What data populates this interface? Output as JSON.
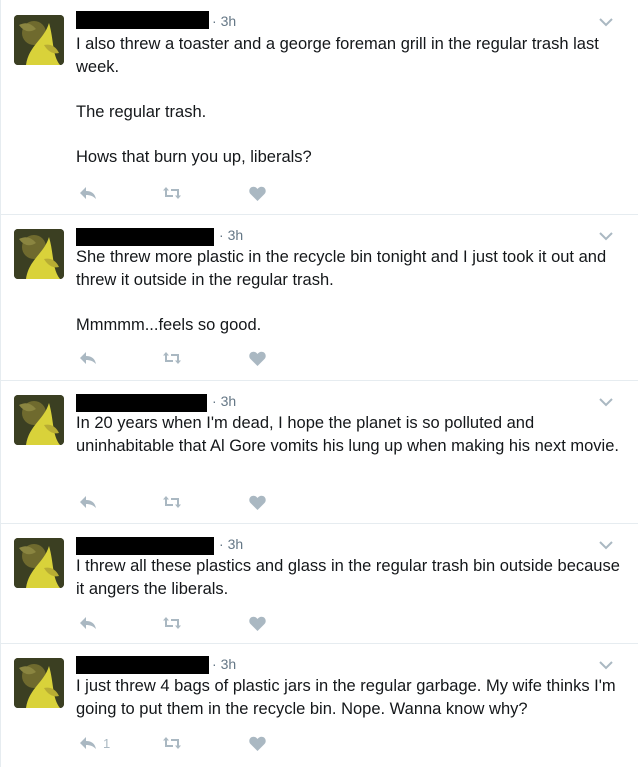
{
  "tweets": [
    {
      "time": "3h",
      "text": "I also threw a toaster and a george foreman grill in the regular trash last week.\n\nThe regular trash.\n\nHows that burn you up, liberals?",
      "reply_count": "",
      "actions": [
        "reply-icon",
        "retweet-icon",
        "like-icon"
      ]
    },
    {
      "time": "3h",
      "text": "She threw more plastic in the recycle bin tonight and I just took it out and threw it outside in the regular trash.\n\nMmmmm...feels so good.",
      "reply_count": "",
      "actions": [
        "reply-icon",
        "retweet-icon",
        "like-icon"
      ]
    },
    {
      "time": "3h",
      "text": "In 20 years when I'm dead, I hope the planet is so polluted and uninhabitable that Al Gore vomits his lung up when making his next movie.",
      "reply_count": "",
      "actions": [
        "reply-icon",
        "retweet-icon",
        "like-icon"
      ]
    },
    {
      "time": "3h",
      "text": "I threw all these plastics and glass in the regular trash bin outside because it angers the liberals.",
      "reply_count": "",
      "actions": [
        "reply-icon",
        "retweet-icon",
        "like-icon"
      ]
    },
    {
      "time": "3h",
      "text": "I just threw 4 bags of plastic jars in the regular garbage. My wife thinks I'm going to put them in the recycle bin. Nope. Wanna know why?",
      "reply_count": "1",
      "actions": [
        "reply-icon",
        "retweet-icon",
        "like-icon"
      ]
    }
  ],
  "colors": {
    "text": "#14171a",
    "meta": "#657786",
    "icon": "#aab8c2",
    "divider": "#e6ecf0",
    "redaction": "#000000"
  }
}
